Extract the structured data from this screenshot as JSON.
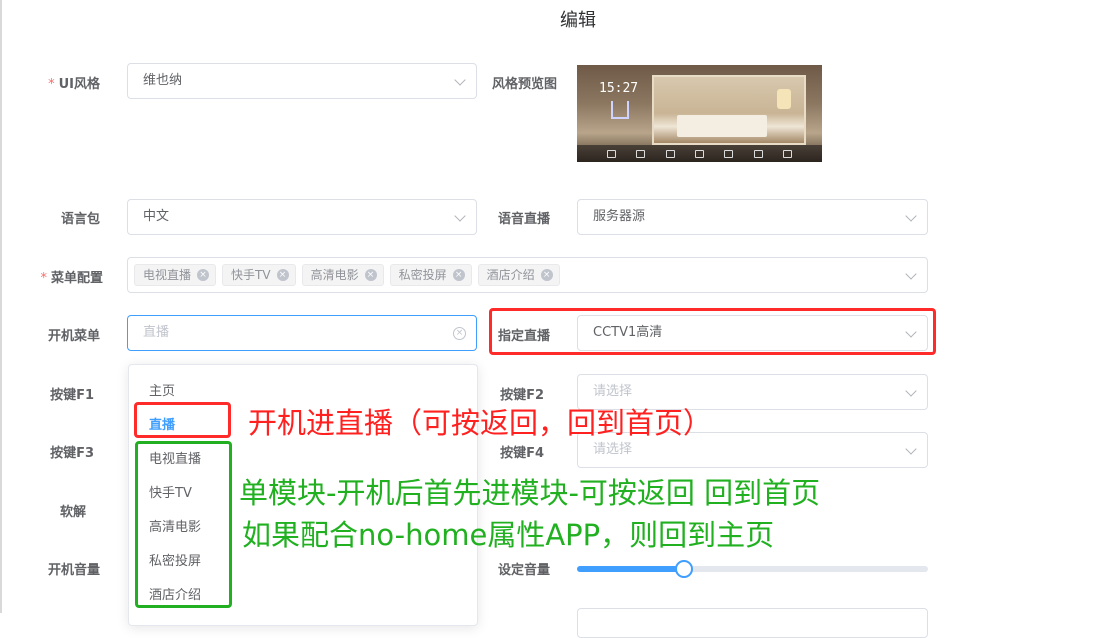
{
  "dialog": {
    "title": "编辑"
  },
  "form": {
    "ui_style": {
      "label": "UI风格",
      "required_mark": "*",
      "value": "维也纳"
    },
    "style_preview": {
      "label": "风格预览图",
      "clock": "15:27"
    },
    "language_pack": {
      "label": "语言包",
      "value": "中文"
    },
    "voice_live": {
      "label": "语音直播",
      "value": "服务器源"
    },
    "menu_config": {
      "label": "菜单配置",
      "required_mark": "*",
      "tags": [
        "电视直播",
        "快手TV",
        "高清电影",
        "私密投屏",
        "酒店介绍"
      ],
      "tag_close": "×"
    },
    "boot_menu": {
      "label": "开机菜单",
      "placeholder": "直播",
      "clear": "×"
    },
    "assigned_live": {
      "label": "指定直播",
      "value": "CCTV1高清"
    },
    "key_f1": {
      "label": "按键F1"
    },
    "key_f2": {
      "label": "按键F2",
      "placeholder": "请选择"
    },
    "key_f3": {
      "label": "按键F3"
    },
    "key_f4": {
      "label": "按键F4",
      "placeholder": "请选择"
    },
    "soft_decode": {
      "label": "软解"
    },
    "boot_volume": {
      "label": "开机音量"
    },
    "set_volume": {
      "label": "设定音量",
      "value_fraction": 0.302
    }
  },
  "dropdown": {
    "options": [
      "主页",
      "直播",
      "电视直播",
      "快手TV",
      "高清电影",
      "私密投屏",
      "酒店介绍"
    ],
    "selected_index": 1
  },
  "annotations": {
    "red": "开机进直播（可按返回，回到首页）",
    "green_line1": "单模块-开机后首先进模块-可按返回 回到首页",
    "green_line2": "如果配合no-home属性APP，则回到主页"
  },
  "colors": {
    "accent": "#409eff",
    "annotation_red": "#ff2020",
    "annotation_green": "#20b020",
    "required": "#f56c6c"
  }
}
